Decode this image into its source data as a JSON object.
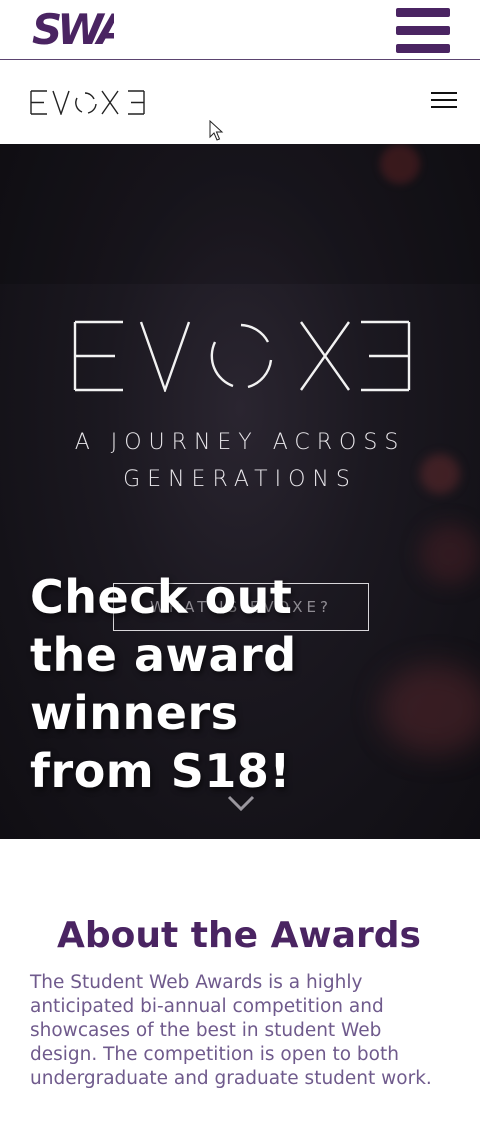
{
  "swa_bar": {
    "logo_text": "SWA",
    "logo_icon": "swa-logo",
    "menu_icon": "hamburger-icon",
    "brand_color": "#4a2462"
  },
  "evoxe_header": {
    "logo_text": "EVOXE",
    "menu_icon": "hamburger-icon"
  },
  "hero": {
    "logo_text": "EVOXE",
    "tagline": "A JOURNEY ACROSS GENERATIONS",
    "button_label": "WHAT IS EVOXE?",
    "scroll_icon": "chevron-down-icon"
  },
  "overlay": {
    "headline": "Check out the award winners from S18!"
  },
  "about": {
    "title": "About the Awards",
    "text": "The Student Web Awards is a highly anticipated bi-annual competition and showcases of the best in student Web design. The competition is open to both undergraduate and graduate student work."
  },
  "colors": {
    "purple": "#4a2462",
    "text_purple": "#6f5a8c",
    "hero_dark": "#141218"
  }
}
